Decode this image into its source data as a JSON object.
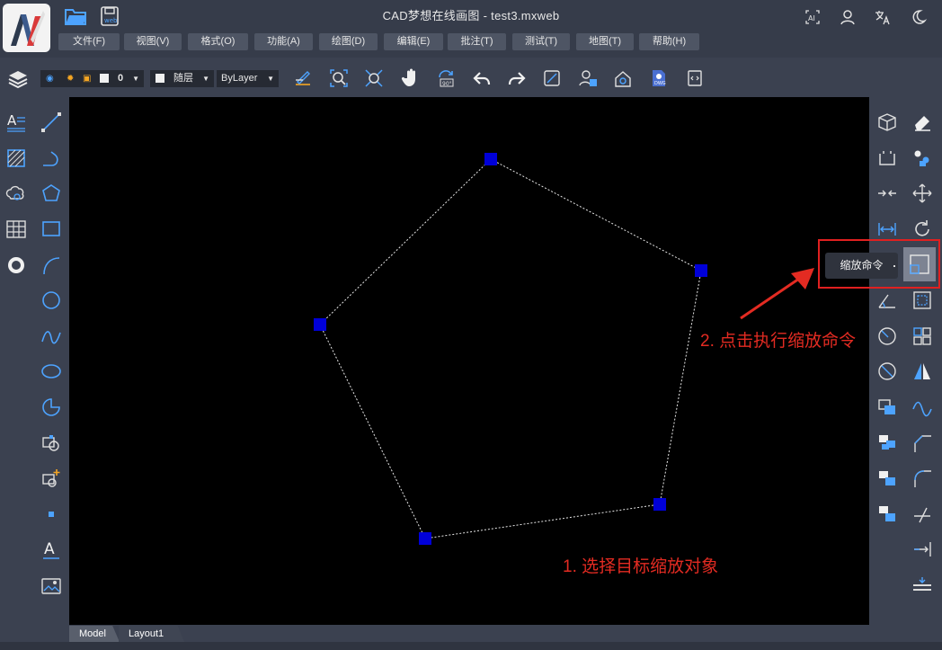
{
  "window": {
    "title": "CAD梦想在线画图 - test3.mxweb"
  },
  "header": {
    "icons": [
      "app-logo",
      "open-folder-icon",
      "save-web-icon"
    ],
    "menu": [
      {
        "label": "文件(F)"
      },
      {
        "label": "视图(V)"
      },
      {
        "label": "格式(O)"
      },
      {
        "label": "功能(A)"
      },
      {
        "label": "绘图(D)"
      },
      {
        "label": "编辑(E)"
      },
      {
        "label": "批注(T)"
      },
      {
        "label": "测试(T)"
      },
      {
        "label": "地图(T)"
      },
      {
        "label": "帮助(H)"
      }
    ],
    "right_icons": [
      "ai-icon",
      "user-icon",
      "translate-icon",
      "dark-mode-icon"
    ]
  },
  "toolbar": {
    "layer_value": "0",
    "color_value": "随层",
    "linetype_value": "ByLayer"
  },
  "colors": {
    "background": "#3b4150",
    "canvas": "#000000",
    "accent": "#4da3ff",
    "grip": "#0000d8",
    "annotation": "#e32b22"
  },
  "layout_tabs": [
    {
      "label": "Model"
    },
    {
      "label": "Layout1"
    }
  ],
  "tooltip": {
    "text": "缩放命令"
  },
  "annotations": {
    "step1": "1. 选择目标缩放对象",
    "step2": "2. 点击执行缩放命令"
  }
}
